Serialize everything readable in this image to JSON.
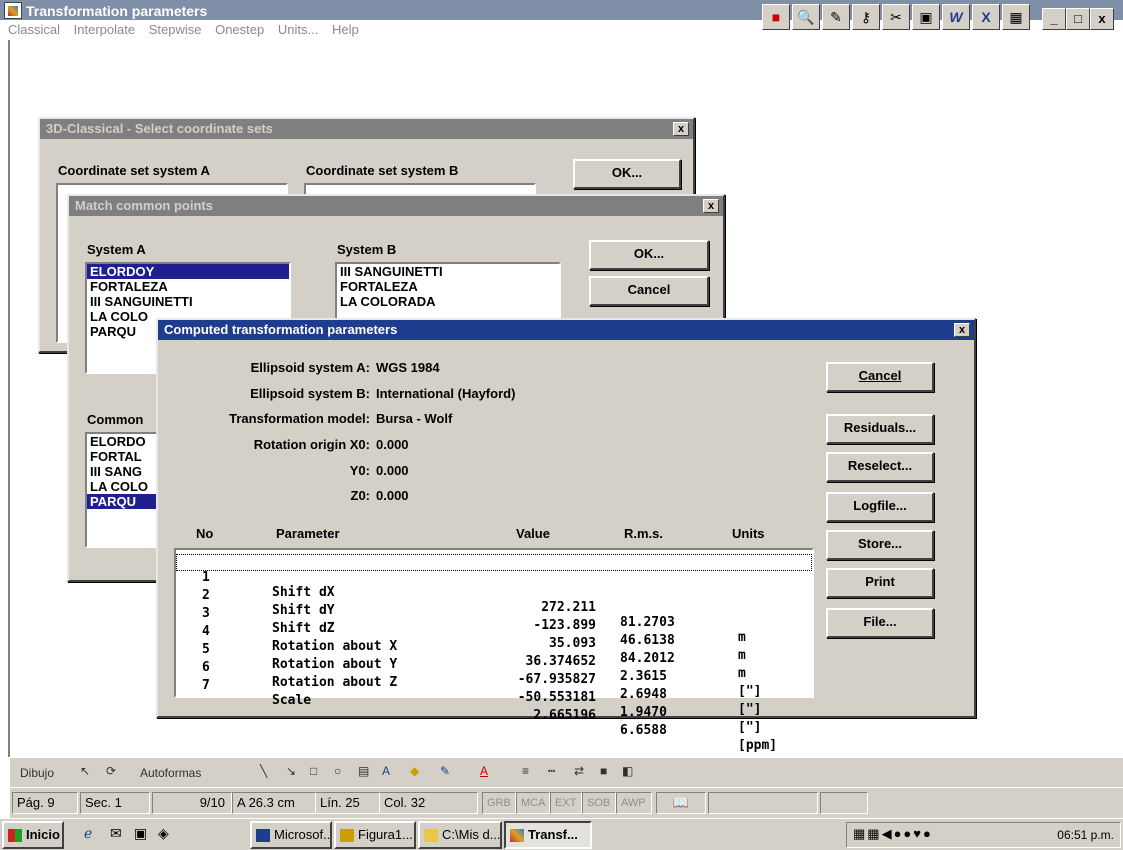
{
  "app": {
    "title": "Transformation parameters",
    "menu": [
      "Classical",
      "Interpolate",
      "Stepwise",
      "Onestep",
      "Units...",
      "Help"
    ],
    "window_controls": [
      "_",
      "□",
      "x"
    ]
  },
  "select_dialog": {
    "title": "3D-Classical - Select coordinate sets",
    "label_a": "Coordinate set system A",
    "label_b": "Coordinate set system B",
    "ok": "OK...",
    "close": "x"
  },
  "match_dialog": {
    "title": "Match common points",
    "label_a": "System A",
    "label_b": "System B",
    "list_a": [
      "ELORDOY",
      "FORTALEZA",
      "III SANGUINETTI",
      "LA COLO",
      "PARQU"
    ],
    "list_a_selected": 0,
    "list_b": [
      "III SANGUINETTI",
      "FORTALEZA",
      "LA COLORADA"
    ],
    "common_label": "Common",
    "common_list": [
      "ELORDO",
      "FORTAL",
      "III SANG",
      "LA COLO",
      "PARQU"
    ],
    "common_selected": 4,
    "ok": "OK...",
    "cancel": "Cancel",
    "close": "x"
  },
  "computed_dialog": {
    "title": "Computed transformation parameters",
    "close": "x",
    "info": [
      {
        "label": "Ellipsoid system A:",
        "value": "WGS 1984"
      },
      {
        "label": "Ellipsoid system B:",
        "value": "International (Hayford)"
      },
      {
        "label": "Transformation model:",
        "value": "Bursa - Wolf"
      },
      {
        "label": "Rotation origin X0:",
        "value": "0.000"
      },
      {
        "label": "Y0:",
        "value": "0.000"
      },
      {
        "label": "Z0:",
        "value": "0.000"
      }
    ],
    "columns": [
      "No",
      "Parameter",
      "Value",
      "R.m.s.",
      "Units"
    ],
    "rows": [
      {
        "no": "1",
        "param": "Shift dX",
        "value": "272.211",
        "rms": "81.2703",
        "units": "m"
      },
      {
        "no": "2",
        "param": "Shift dY",
        "value": "-123.899",
        "rms": "46.6138",
        "units": "m"
      },
      {
        "no": "3",
        "param": "Shift dZ",
        "value": "35.093",
        "rms": "84.2012",
        "units": "m"
      },
      {
        "no": "4",
        "param": "Rotation about X",
        "value": "36.374652",
        "rms": "2.3615",
        "units": "[\"]"
      },
      {
        "no": "5",
        "param": "Rotation about Y",
        "value": "-67.935827",
        "rms": "2.6948",
        "units": "[\"]"
      },
      {
        "no": "6",
        "param": "Rotation about Z",
        "value": "-50.553181",
        "rms": "1.9470",
        "units": "[\"]"
      },
      {
        "no": "7",
        "param": "Scale",
        "value": "2.665196",
        "rms": "6.6588",
        "units": "[ppm]"
      }
    ],
    "buttons": [
      "Cancel",
      "Residuals...",
      "Reselect...",
      "Logfile...",
      "Store...",
      "Print",
      "File..."
    ]
  },
  "drawbar": {
    "dibujo": "Dibujo",
    "autoformas": "Autoformas"
  },
  "status": {
    "page": "Pág. 9",
    "section": "Sec. 1",
    "pages": "9/10",
    "position": "A 26.3 cm",
    "line": "Lín. 25",
    "col": "Col. 32",
    "flags": [
      "GRB",
      "MCA",
      "EXT",
      "SOB",
      "AWP"
    ]
  },
  "taskbar": {
    "start": "Inicio",
    "tasks": [
      "Microsof...",
      "Figura1....",
      "C:\\Mis d...",
      "Transf..."
    ],
    "clock": "06:51 p.m."
  }
}
